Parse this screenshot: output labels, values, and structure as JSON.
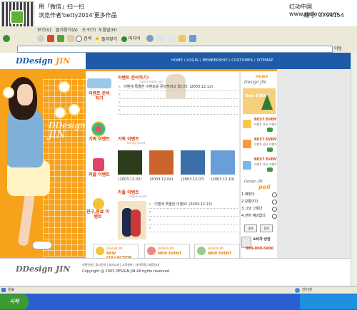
{
  "watermark": {
    "line1": "用「微信」扫一扫",
    "line2": "浏览作者'betty2014'更多作品",
    "site": "红动中国 www.redocn.com",
    "code": "编号: 3794154"
  },
  "menubar": {
    "items": [
      "보기(V)",
      "즐겨찾기(A)",
      "도구(T)",
      "도움말(H)"
    ]
  },
  "toolbar": {
    "search": "검색",
    "favorites": "즐겨찾기",
    "media": "미디어"
  },
  "addressbar": {
    "go": "이동"
  },
  "site": {
    "logo_main": "DDesign",
    "logo_accent": "JIN",
    "nav": "HOME / LOGIN / MEMBERSHIP / CUSTOMER / SITEMAP",
    "brand_line1": "DDesign",
    "brand_line2": "JIN"
  },
  "side_labels": [
    "이벤트 준비하기",
    "가족 이벤트",
    "커플 이벤트",
    "친구,동료 이벤트"
  ],
  "section1": {
    "title": "이벤트 준비하기!",
    "subtitle": "event ready go!",
    "rows": [
      "이벤에 특별한 이벤트를 준비하려고 합니다. (2003.12.12)",
      "",
      "",
      ""
    ]
  },
  "section2": {
    "title": "가족 이벤트",
    "subtitle": "family event",
    "photos": [
      {
        "caption": "(2003.12.02)",
        "color": "#2b3d1a"
      },
      {
        "caption": "(2003.12.04)",
        "color": "#c9642a"
      },
      {
        "caption": "(2003.12.07)",
        "color": "#3a6fa8"
      },
      {
        "caption": "(2003.12.10)",
        "color": "#6a9ed8"
      }
    ]
  },
  "section3": {
    "title": "커플 이벤트",
    "subtitle": "couple event",
    "rows": [
      "이벤에 특별한 이벤트! (2003.12.12)",
      "",
      "",
      ""
    ]
  },
  "banners": [
    {
      "line1": "DESIGN JIN",
      "line2": "NEW COLLACTION"
    },
    {
      "line1": "DESIGN JIN",
      "line2": "NEW EVENT"
    },
    {
      "line1": "DESIGN JIN",
      "line2": "NEW EVENT"
    }
  ],
  "right": {
    "news_title": "news",
    "news_brand": "Design JIN",
    "news_tag": "Best EVENT",
    "best1": "BEST EVENT",
    "best1_sub": "이벤트 준비 이벤트",
    "best2": "BEST EVENT",
    "best2_sub": "이벤트 준비 이벤트",
    "best3": "BEST EVENT",
    "best3_sub": "이벤트 준비 이벤트",
    "poll_title": "Design JIN",
    "poll_word": "poll",
    "poll_options": [
      "1.재밌다",
      "2.보통이다",
      "3.그냥 그렇다",
      "4.전혀 재미없다"
    ],
    "poll_result": "결과",
    "poll_vote": "참여",
    "contact_label": "소비자 상담",
    "contact_number": "080-000-5000"
  },
  "footer": {
    "logo_main": "DDesign",
    "logo_accent": "JIN",
    "links": "이용안내 | 광고문의 | 회사소개 | 고객센터 | 사이트맵 | 제휴안내",
    "copyright": "Copyright @ 2003 DESIGN JIN  All rights reserved."
  },
  "status": {
    "left": "완료",
    "right": "인터넷"
  },
  "taskbar": {
    "start": "시작"
  }
}
